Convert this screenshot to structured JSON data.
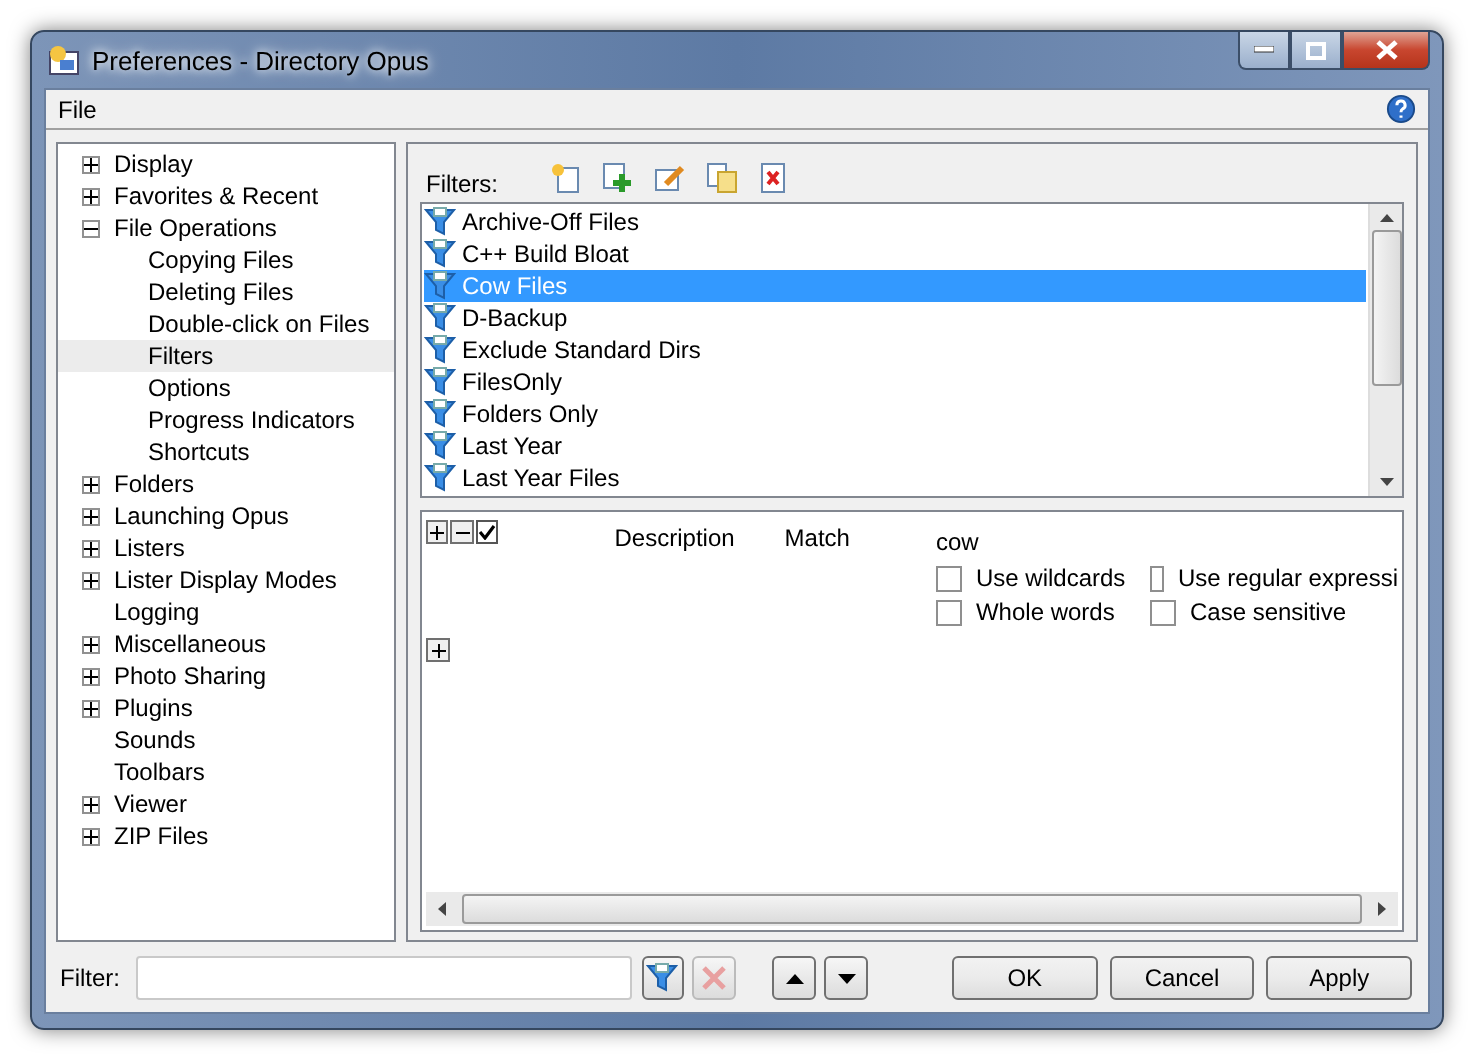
{
  "window": {
    "title": "Preferences - Directory Opus"
  },
  "menu": [
    "File"
  ],
  "tree": [
    {
      "label": "Display",
      "expanded": false,
      "selected": false
    },
    {
      "label": "Favorites & Recent",
      "expanded": false,
      "selected": false
    },
    {
      "label": "File Operations",
      "expanded": true,
      "selected": false,
      "children": [
        {
          "label": "Copying Files",
          "selected": false
        },
        {
          "label": "Deleting Files",
          "selected": false
        },
        {
          "label": "Double-click on Files",
          "selected": false
        },
        {
          "label": "Filters",
          "selected": true
        },
        {
          "label": "Options",
          "selected": false
        },
        {
          "label": "Progress Indicators",
          "selected": false
        },
        {
          "label": "Shortcuts",
          "selected": false
        }
      ]
    },
    {
      "label": "Folders",
      "expanded": false,
      "selected": false
    },
    {
      "label": "Launching Opus",
      "expanded": false,
      "selected": false
    },
    {
      "label": "Listers",
      "expanded": false,
      "selected": false
    },
    {
      "label": "Lister Display Modes",
      "expanded": false,
      "selected": false
    },
    {
      "label": "Logging",
      "selected": false
    },
    {
      "label": "Miscellaneous",
      "expanded": false,
      "selected": false
    },
    {
      "label": "Photo Sharing",
      "expanded": false,
      "selected": false
    },
    {
      "label": "Plugins",
      "expanded": false,
      "selected": false
    },
    {
      "label": "Sounds",
      "selected": false
    },
    {
      "label": "Toolbars",
      "selected": false
    },
    {
      "label": "Viewer",
      "expanded": false,
      "selected": false
    },
    {
      "label": "ZIP Files",
      "expanded": false,
      "selected": false
    }
  ],
  "filters": {
    "label": "Filters:",
    "items": [
      {
        "label": "Archive-Off Files",
        "selected": false
      },
      {
        "label": "C++ Build Bloat",
        "selected": false
      },
      {
        "label": "Cow Files",
        "selected": true
      },
      {
        "label": "D-Backup",
        "selected": false
      },
      {
        "label": "Exclude Standard Dirs",
        "selected": false
      },
      {
        "label": "FilesOnly",
        "selected": false
      },
      {
        "label": "Folders Only",
        "selected": false
      },
      {
        "label": "Last Year",
        "selected": false
      },
      {
        "label": "Last Year Files",
        "selected": false
      }
    ]
  },
  "clause": {
    "enabled": true,
    "description": "Description",
    "match": "Match",
    "value": "cow",
    "options": [
      {
        "label": "Use wildcards",
        "checked": false
      },
      {
        "label": "Use regular expressi",
        "checked": false
      },
      {
        "label": "Whole words",
        "checked": false
      },
      {
        "label": "Case sensitive",
        "checked": false
      }
    ]
  },
  "footer": {
    "filter_label": "Filter:",
    "buttons": [
      "OK",
      "Cancel",
      "Apply"
    ]
  }
}
